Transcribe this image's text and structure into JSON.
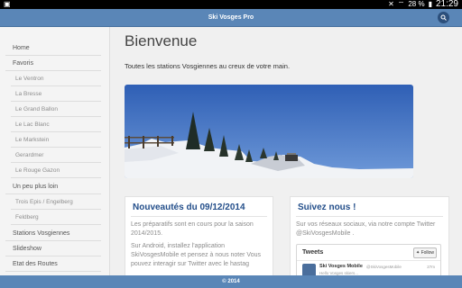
{
  "statusbar": {
    "battery": "28 %",
    "time": "21:29"
  },
  "app": {
    "title": "Ski Vosges Pro"
  },
  "sidebar": {
    "items": [
      {
        "label": "Home",
        "sub": false
      },
      {
        "label": "Favoris",
        "sub": false
      },
      {
        "label": "Le Ventron",
        "sub": true
      },
      {
        "label": "La Bresse",
        "sub": true
      },
      {
        "label": "Le Grand Ballon",
        "sub": true
      },
      {
        "label": "Le Lac Blanc",
        "sub": true
      },
      {
        "label": "Le Markstein",
        "sub": true
      },
      {
        "label": "Gerardmer",
        "sub": true
      },
      {
        "label": "Le Rouge Gazon",
        "sub": true
      },
      {
        "label": "Un peu plus loin",
        "sub": false
      },
      {
        "label": "Trois Epis / Engelberg",
        "sub": true
      },
      {
        "label": "Feldberg",
        "sub": true
      },
      {
        "label": "Stations Vosgiennes",
        "sub": false
      },
      {
        "label": "Slideshow",
        "sub": false
      },
      {
        "label": "Etat des Routes",
        "sub": false
      }
    ]
  },
  "main": {
    "heading": "Bienvenue",
    "tagline": "Toutes les stations Vosgiennes au creux de votre main."
  },
  "news": {
    "title": "Nouveautés du 09/12/2014",
    "line1": "Les préparatifs sont en cours pour la saison",
    "line2": "2014/2015.",
    "line3": "Sur Android, installez l'application",
    "line4": "SkiVosgesMobile et pensez à nous noter Vous",
    "line5": "pouvez interagir sur Twitter avec le hastag"
  },
  "social": {
    "title": "Suivez nous !",
    "line1": "Sur vos réseaux sociaux, via notre compte Twitter",
    "line2": "@SkiVosgesMobile .",
    "widget_title": "Tweets",
    "follow_label": "Follow",
    "tweet_name": "Ski Vosges Mobile",
    "tweet_handle": "@SkiVosgesMobile",
    "tweet_age": "27m",
    "tweet_text": "Hello Vosges skiers..."
  },
  "footer": {
    "text": "© 2014"
  },
  "colors": {
    "topbar": "#5a86b7",
    "heading_blue": "#234e8a"
  }
}
